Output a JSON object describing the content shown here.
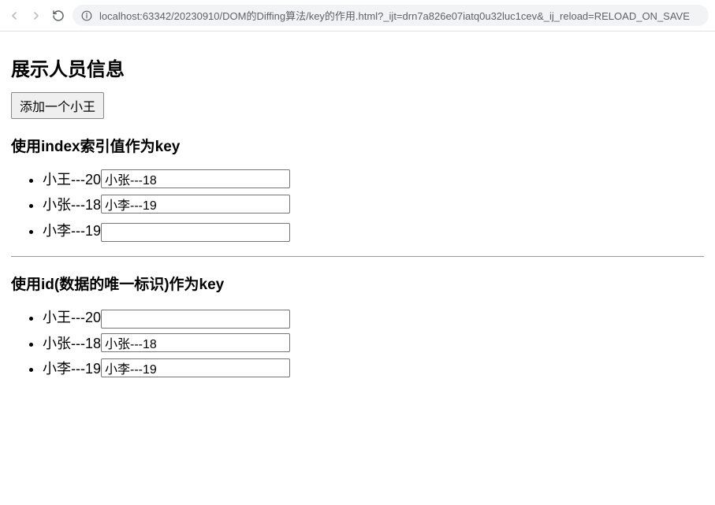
{
  "browser": {
    "url": "localhost:63342/20230910/DOM的Diffing算法/key的作用.html?_ijt=drn7a826e07iatq0u32luc1cev&_ij_reload=RELOAD_ON_SAVE"
  },
  "page": {
    "title": "展示人员信息",
    "add_button_label": "添加一个小王",
    "section1": {
      "heading": "使用index索引值作为key",
      "items": [
        {
          "text": "小王---20",
          "input_value": "小张---18"
        },
        {
          "text": "小张---18",
          "input_value": "小李---19"
        },
        {
          "text": "小李---19",
          "input_value": ""
        }
      ]
    },
    "section2": {
      "heading": "使用id(数据的唯一标识)作为key",
      "items": [
        {
          "text": "小王---20",
          "input_value": ""
        },
        {
          "text": "小张---18",
          "input_value": "小张---18"
        },
        {
          "text": "小李---19",
          "input_value": "小李---19"
        }
      ]
    }
  }
}
